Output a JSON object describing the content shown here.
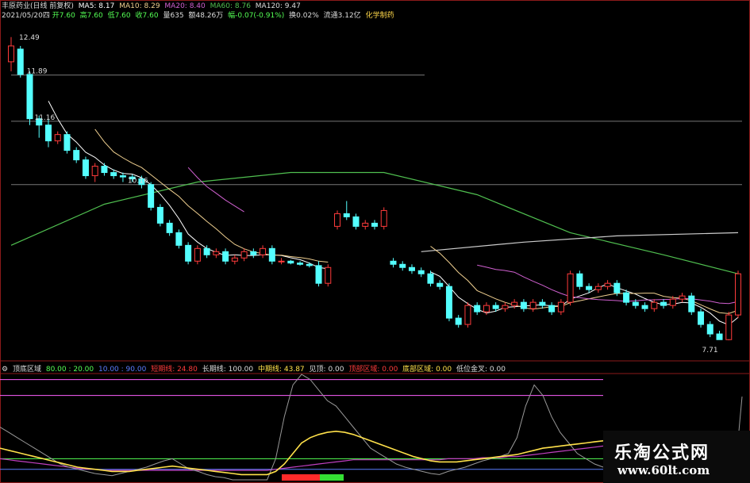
{
  "header": {
    "title": "丰原药业(日线 前复权)",
    "ma5": "MA5: 8.17",
    "ma10": "MA10: 8.29",
    "ma20": "MA20: 8.40",
    "ma60": "MA60: 8.76",
    "ma120": "MA120: 9.47",
    "info_date": "2021/05/20四",
    "info_open": "开7.60",
    "info_high": "高7.60",
    "info_low": "低7.60",
    "info_close": "收7.60",
    "info_vol": "量635",
    "info_amount": "额48.26万",
    "info_change": "幅-0.07(-0.91%)",
    "info_turnover": "换0.02%",
    "info_float": "流通3.12亿",
    "info_sector": "化学制药"
  },
  "indicator": {
    "name": "顶底区域",
    "v1": "80.00 : 20.00",
    "v2": "10.00 : 90.00",
    "short": "短期线: 24.80",
    "long": "长期线: 100.00",
    "mid": "中期线: 43.87",
    "sell": "见顶: 0.00",
    "top": "顶部区域: 0.00",
    "bottom": "底部区域: 0.00",
    "lowcross": "低位金叉: 0.00"
  },
  "watermark": {
    "title": "乐淘公式网",
    "url": "www.60lt.com"
  },
  "colors": {
    "up": "#ff3b3b",
    "down": "#54ffff",
    "ma5": "#ffffff",
    "ma10": "#f0d090",
    "ma20": "#d060d0",
    "ma60": "#50c050",
    "short": "#999999",
    "mid": "#ffe14a",
    "long": "#ff60ff"
  },
  "chart_data": {
    "type": "candlestick",
    "annotations": [
      "12.49",
      "11.89",
      "11.16",
      "10.16",
      "7.71"
    ],
    "ylim": [
      7.5,
      12.7
    ],
    "candles": [
      [
        0,
        12.1,
        12.35,
        11.95,
        12.49
      ],
      [
        1,
        12.3,
        11.9,
        11.85,
        12.35
      ],
      [
        2,
        11.9,
        11.2,
        11.1,
        11.95
      ],
      [
        3,
        11.2,
        11.1,
        10.9,
        11.25
      ],
      [
        4,
        11.1,
        10.85,
        10.75,
        11.2
      ],
      [
        5,
        10.85,
        10.95,
        10.8,
        11.0
      ],
      [
        6,
        10.95,
        10.7,
        10.65,
        11.0
      ],
      [
        7,
        10.7,
        10.55,
        10.5,
        10.75
      ],
      [
        8,
        10.55,
        10.3,
        10.25,
        10.6
      ],
      [
        9,
        10.3,
        10.45,
        10.2,
        10.5
      ],
      [
        10,
        10.45,
        10.35,
        10.3,
        10.5
      ],
      [
        11,
        10.35,
        10.3,
        10.25,
        10.4
      ],
      [
        12,
        10.3,
        10.28,
        10.2,
        10.35
      ],
      [
        13,
        10.28,
        10.25,
        10.2,
        10.32
      ],
      [
        14,
        10.25,
        10.16,
        10.1,
        10.3
      ],
      [
        15,
        10.16,
        9.8,
        9.75,
        10.2
      ],
      [
        16,
        9.8,
        9.55,
        9.5,
        9.85
      ],
      [
        17,
        9.55,
        9.4,
        9.35,
        9.6
      ],
      [
        18,
        9.4,
        9.2,
        9.15,
        9.45
      ],
      [
        19,
        9.2,
        8.95,
        8.9,
        9.25
      ],
      [
        20,
        8.95,
        9.15,
        8.9,
        9.2
      ],
      [
        21,
        9.15,
        9.05,
        9.0,
        9.2
      ],
      [
        22,
        9.05,
        9.1,
        9.0,
        9.15
      ],
      [
        23,
        9.1,
        8.95,
        8.9,
        9.15
      ],
      [
        24,
        8.95,
        9.0,
        8.9,
        9.05
      ],
      [
        25,
        9.0,
        9.1,
        8.95,
        9.15
      ],
      [
        26,
        9.1,
        9.05,
        9.0,
        9.15
      ],
      [
        27,
        9.05,
        9.15,
        9.0,
        9.2
      ],
      [
        28,
        9.15,
        8.95,
        8.9,
        9.2
      ],
      [
        29,
        8.95,
        8.95,
        8.9,
        9.0
      ],
      [
        30,
        8.95,
        8.92,
        8.9,
        8.97
      ],
      [
        31,
        8.92,
        8.9,
        8.88,
        8.95
      ],
      [
        32,
        8.9,
        8.88,
        8.85,
        8.93
      ],
      [
        33,
        8.88,
        8.6,
        8.55,
        8.95
      ],
      [
        34,
        8.6,
        8.85,
        8.55,
        8.9
      ],
      [
        35,
        9.5,
        9.7,
        9.45,
        9.75
      ],
      [
        36,
        9.7,
        9.65,
        9.6,
        9.9
      ],
      [
        37,
        9.65,
        9.5,
        9.45,
        9.7
      ],
      [
        38,
        9.5,
        9.55,
        9.45,
        9.6
      ],
      [
        39,
        9.55,
        9.5,
        9.45,
        9.6
      ],
      [
        40,
        9.5,
        9.75,
        9.45,
        9.8
      ],
      [
        41,
        8.95,
        8.9,
        8.85,
        9.0
      ],
      [
        42,
        8.9,
        8.85,
        8.8,
        8.95
      ],
      [
        43,
        8.85,
        8.8,
        8.75,
        8.9
      ],
      [
        44,
        8.8,
        8.75,
        8.7,
        8.85
      ],
      [
        45,
        8.75,
        8.6,
        8.55,
        8.8
      ],
      [
        46,
        8.6,
        8.55,
        8.5,
        8.65
      ],
      [
        47,
        8.55,
        8.05,
        8.0,
        8.6
      ],
      [
        48,
        8.05,
        7.95,
        7.9,
        8.1
      ],
      [
        49,
        7.95,
        8.25,
        7.9,
        8.3
      ],
      [
        50,
        8.25,
        8.15,
        8.1,
        8.3
      ],
      [
        51,
        8.15,
        8.25,
        8.1,
        8.3
      ],
      [
        52,
        8.25,
        8.2,
        8.15,
        8.3
      ],
      [
        53,
        8.2,
        8.25,
        8.15,
        8.3
      ],
      [
        54,
        8.25,
        8.3,
        8.2,
        8.35
      ],
      [
        55,
        8.3,
        8.2,
        8.15,
        8.35
      ],
      [
        56,
        8.2,
        8.3,
        8.15,
        8.35
      ],
      [
        57,
        8.3,
        8.25,
        8.2,
        8.35
      ],
      [
        58,
        8.25,
        8.15,
        8.1,
        8.3
      ],
      [
        59,
        8.15,
        8.3,
        8.1,
        8.35
      ],
      [
        60,
        8.3,
        8.75,
        8.25,
        8.8
      ],
      [
        61,
        8.75,
        8.55,
        8.5,
        8.8
      ],
      [
        62,
        8.55,
        8.5,
        8.45,
        8.6
      ],
      [
        63,
        8.5,
        8.55,
        8.45,
        8.6
      ],
      [
        64,
        8.55,
        8.6,
        8.5,
        8.65
      ],
      [
        65,
        8.6,
        8.45,
        8.4,
        8.65
      ],
      [
        66,
        8.45,
        8.3,
        8.25,
        8.5
      ],
      [
        67,
        8.3,
        8.25,
        8.2,
        8.35
      ],
      [
        68,
        8.25,
        8.2,
        8.15,
        8.3
      ],
      [
        69,
        8.2,
        8.3,
        8.15,
        8.35
      ],
      [
        70,
        8.3,
        8.25,
        8.2,
        8.35
      ],
      [
        71,
        8.25,
        8.35,
        8.2,
        8.4
      ],
      [
        72,
        8.35,
        8.4,
        8.3,
        8.45
      ],
      [
        73,
        8.4,
        8.15,
        8.1,
        8.45
      ],
      [
        74,
        8.15,
        7.95,
        7.9,
        8.2
      ],
      [
        75,
        7.95,
        7.8,
        7.75,
        8.0
      ],
      [
        76,
        7.8,
        7.71,
        7.71,
        7.85
      ],
      [
        77,
        7.71,
        8.1,
        7.7,
        8.15
      ],
      [
        78,
        8.1,
        8.75,
        8.05,
        8.8
      ]
    ],
    "ma60_curve": [
      [
        0,
        9.2
      ],
      [
        10,
        9.85
      ],
      [
        20,
        10.2
      ],
      [
        30,
        10.35
      ],
      [
        40,
        10.35
      ],
      [
        50,
        10.0
      ],
      [
        60,
        9.4
      ],
      [
        70,
        9.05
      ],
      [
        78,
        8.75
      ]
    ],
    "ma120_curve": [
      [
        44,
        9.1
      ],
      [
        55,
        9.25
      ],
      [
        65,
        9.35
      ],
      [
        78,
        9.4
      ]
    ]
  }
}
